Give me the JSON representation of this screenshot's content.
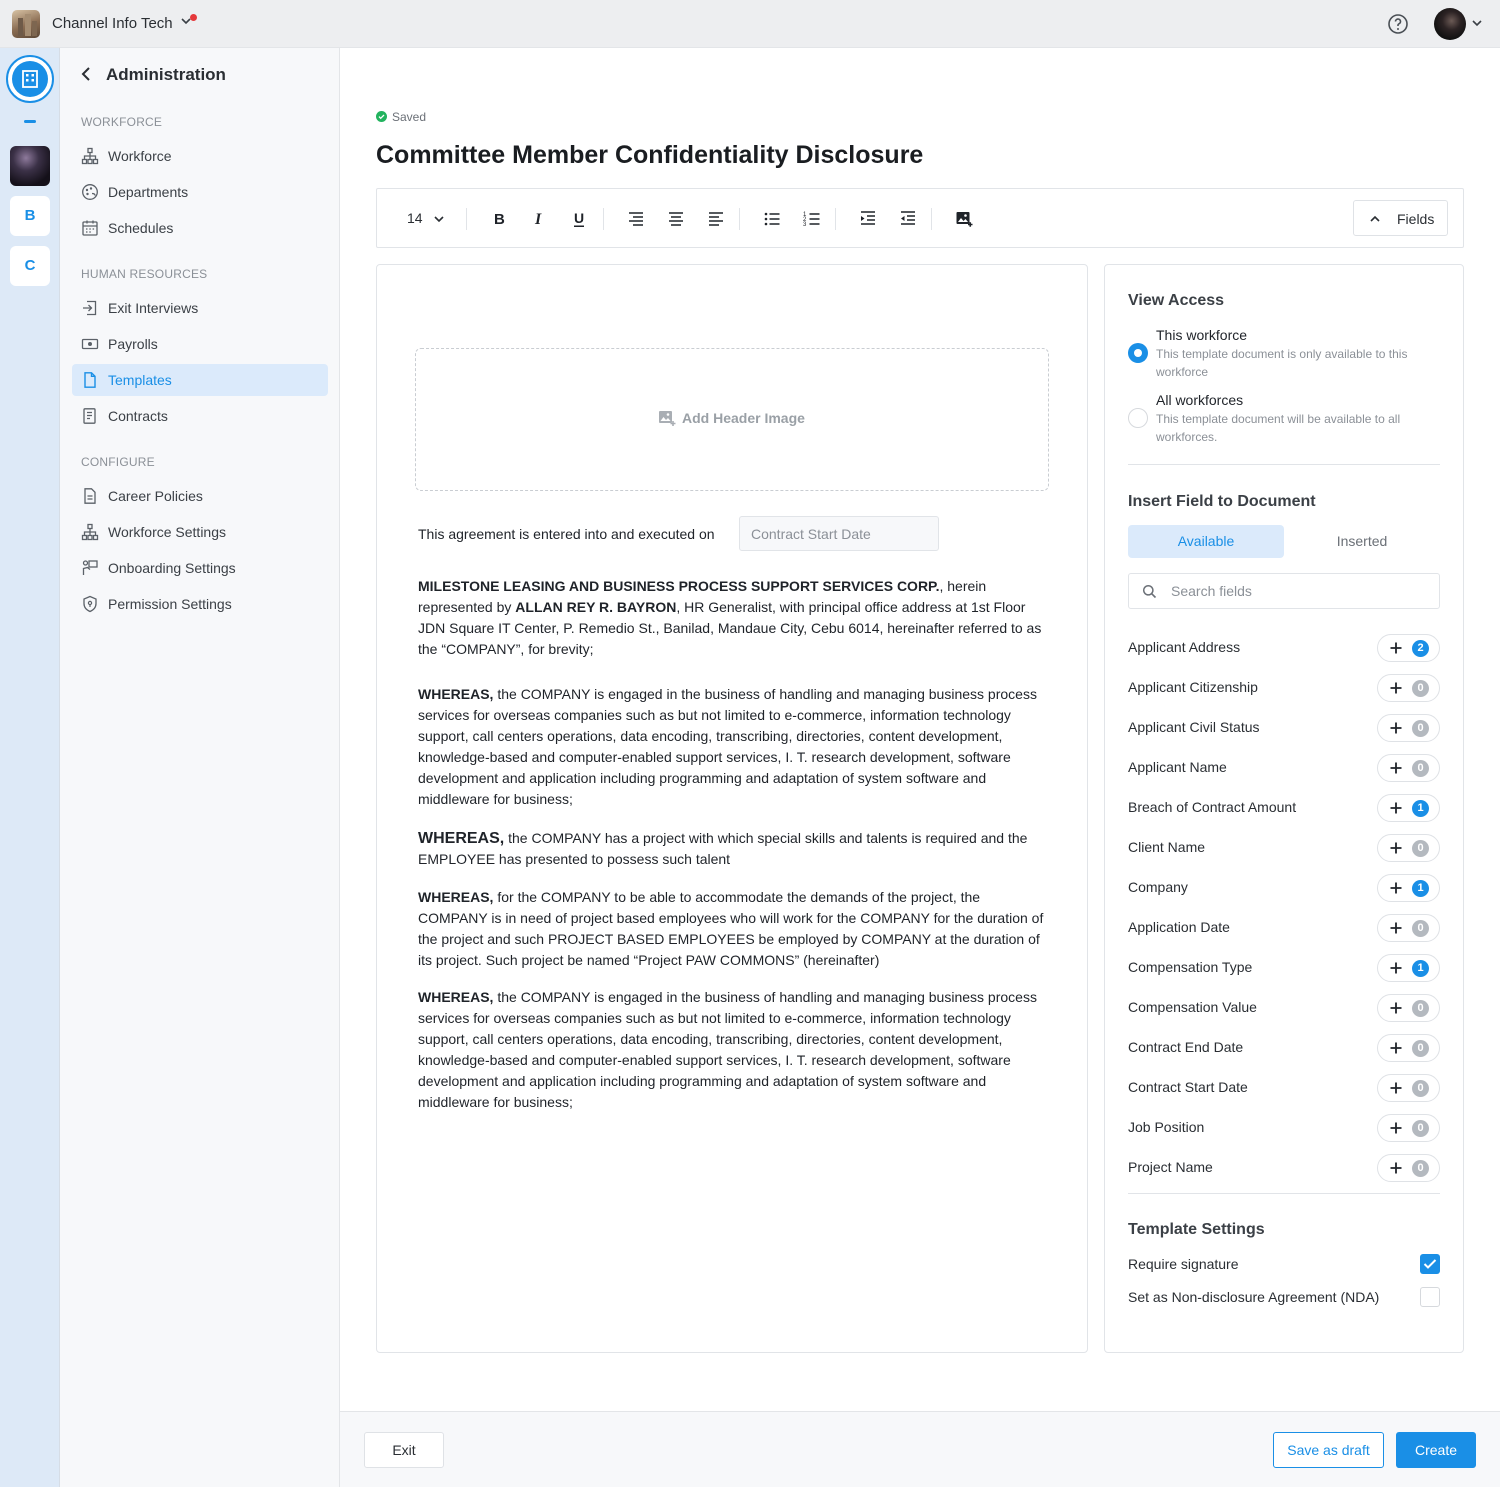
{
  "topbar": {
    "org_name": "Channel Info Tech"
  },
  "rail": {
    "letters": [
      "B",
      "C"
    ]
  },
  "sidebar": {
    "title": "Administration",
    "sections": [
      {
        "label": "WORKFORCE",
        "items": [
          "Workforce",
          "Departments",
          "Schedules"
        ]
      },
      {
        "label": "HUMAN RESOURCES",
        "items": [
          "Exit Interviews",
          "Payrolls",
          "Templates",
          "Contracts"
        ]
      },
      {
        "label": "CONFIGURE",
        "items": [
          "Career Policies",
          "Workforce Settings",
          "Onboarding Settings",
          "Permission Settings"
        ]
      }
    ],
    "active_item": "Templates"
  },
  "main": {
    "status": "Saved",
    "title": "Committee Member Confidentiality Disclosure"
  },
  "toolbar": {
    "font_size": "14",
    "fields_label": "Fields"
  },
  "editor": {
    "header_image_label": "Add Header Image",
    "agreement_intro": "This agreement is entered into and executed on",
    "agreement_field": "Contract Start Date",
    "p1": {
      "company": "MILESTONE LEASING AND BUSINESS PROCESS SUPPORT SERVICES CORP.",
      "t1": ", herein represented by ",
      "rep": "ALLAN REY R. BAYRON",
      "t2": ", HR Generalist, with principal office address at 1st Floor JDN Square IT Center, P. Remedio St., Banilad, Mandaue City, Cebu 6014, hereinafter referred to as the “COMPANY”, for brevity;"
    },
    "whereas": "WHEREAS,",
    "p2": " the COMPANY is engaged in the business of handling and managing business process services for overseas companies such as but not limited to e-commerce, information technology support, call centers operations, data encoding, transcribing, directories, content development, knowledge-based and computer-enabled support services, I. T. research development, software development and application including programming and adaptation of system software and middleware for business;",
    "p3": " the COMPANY has a project with which special skills and talents is required and the EMPLOYEE has presented to possess such talent",
    "p4": " for the COMPANY to be able to accommodate the demands of the project, the COMPANY is in need of project based employees who will work for the COMPANY for the duration of the project and such PROJECT BASED EMPLOYEES be employed by COMPANY at the duration of its project. Such project be named “Project PAW COMMONS” (hereinafter)",
    "p5": " the COMPANY is engaged in the business of handling and managing business process services for overseas companies such as but not limited to e-commerce, information technology support, call centers operations, data encoding, transcribing, directories, content development, knowledge-based and computer-enabled support services, I. T. research development, software development and application including programming and adaptation of system software and middleware for business;"
  },
  "panel": {
    "view_access_title": "View Access",
    "options": [
      {
        "title": "This workforce",
        "desc": "This template document is only available to this workforce",
        "selected": true
      },
      {
        "title": "All workforces",
        "desc": "This template document will be available to all workforces.",
        "selected": false
      }
    ],
    "insert_title": "Insert Field to Document",
    "tabs": [
      "Available",
      "Inserted"
    ],
    "search_placeholder": "Search fields",
    "fields": [
      {
        "name": "Applicant Address",
        "count": "2"
      },
      {
        "name": "Applicant Citizenship",
        "count": "0"
      },
      {
        "name": "Applicant Civil Status",
        "count": "0"
      },
      {
        "name": "Applicant Name",
        "count": "0"
      },
      {
        "name": "Breach of Contract Amount",
        "count": "1"
      },
      {
        "name": "Client Name",
        "count": "0"
      },
      {
        "name": "Company",
        "count": "1"
      },
      {
        "name": "Application Date",
        "count": "0"
      },
      {
        "name": "Compensation Type",
        "count": "1"
      },
      {
        "name": "Compensation Value",
        "count": "0"
      },
      {
        "name": "Contract End Date",
        "count": "0"
      },
      {
        "name": "Contract Start Date",
        "count": "0"
      },
      {
        "name": "Job Position",
        "count": "0"
      },
      {
        "name": "Project Name",
        "count": "0"
      }
    ],
    "settings_title": "Template Settings",
    "settings": [
      {
        "label": "Require signature",
        "checked": true
      },
      {
        "label": "Set as Non-disclosure Agreement (NDA)",
        "checked": false
      }
    ]
  },
  "footer": {
    "exit": "Exit",
    "save_draft": "Save as draft",
    "create": "Create"
  },
  "colors": {
    "accent": "#1a8fe6",
    "saved_green": "#22b35e"
  }
}
